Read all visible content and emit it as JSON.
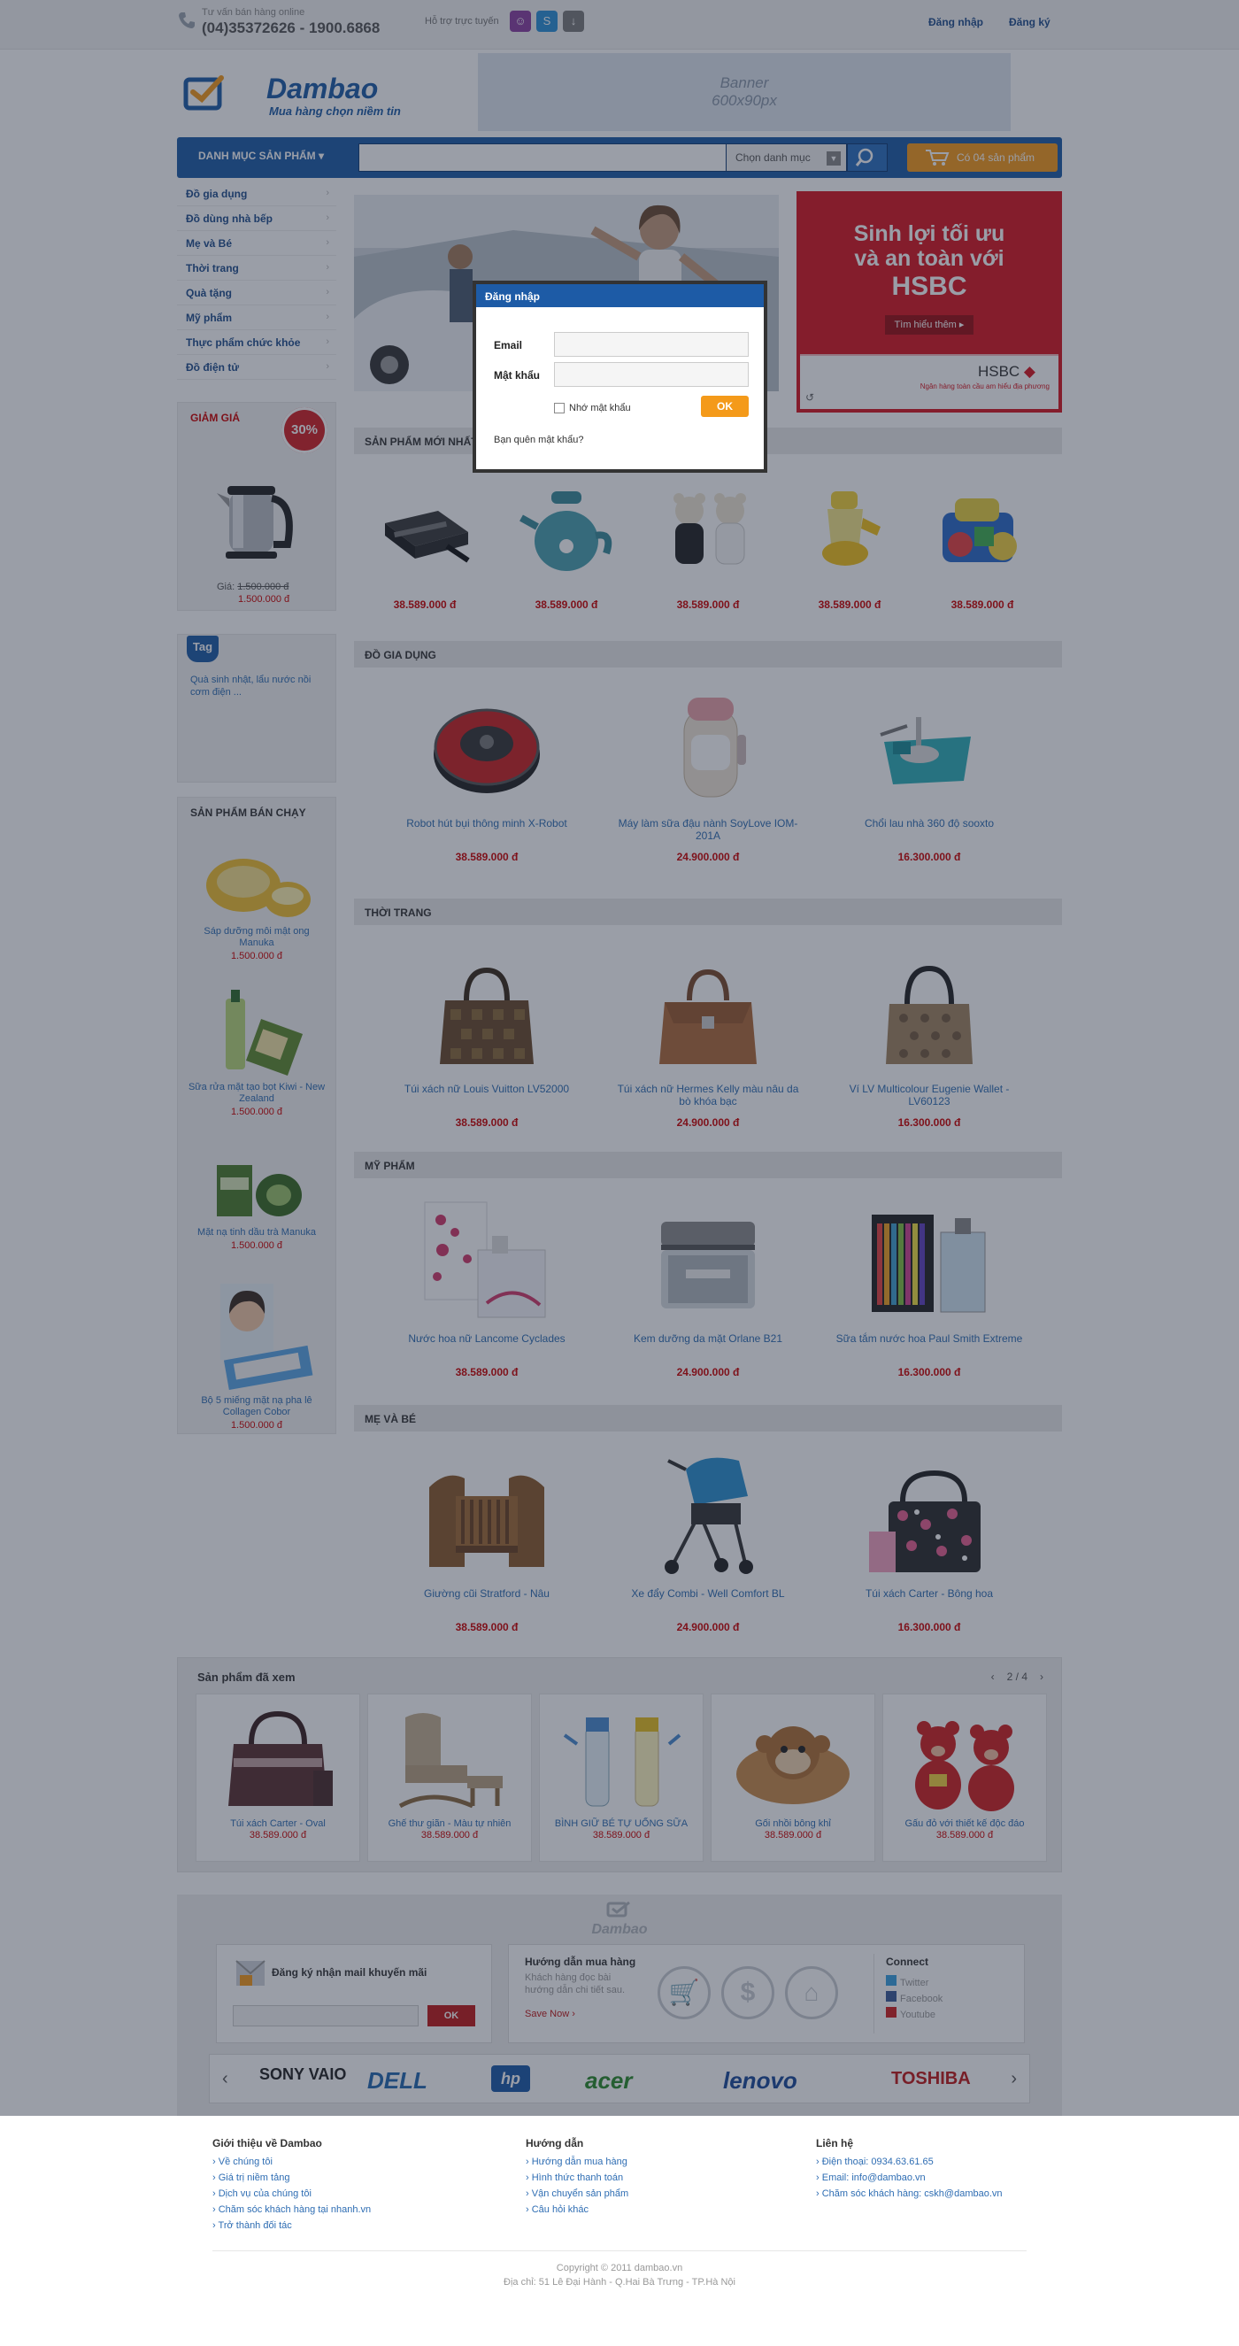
{
  "topbar": {
    "hotline_label": "Tư vấn bán hàng online",
    "hotline_phone": "(04)35372626 - 1900.6868",
    "support_label": "Hỗ trợ trực tuyến",
    "login": "Đăng nhập",
    "register": "Đăng ký"
  },
  "header": {
    "logo_name": "Dambao",
    "logo_slogan": "Mua hàng chọn niềm tin",
    "banner_line1": "Banner",
    "banner_line2": "600x90px"
  },
  "nav": {
    "category_label": "DANH MỤC SẢN PHẨM",
    "search_value": "",
    "category_select": "Chọn danh mục",
    "cart_label": "Có 04 sản phẩm"
  },
  "sidebar": {
    "categories": [
      "Đồ gia dụng",
      "Đồ dùng nhà bếp",
      "Mẹ và Bé",
      "Thời trang",
      "Quà tặng",
      "Mỹ phẩm",
      "Thực phẩm chức khỏe",
      "Đồ điện tử"
    ],
    "discount_title": "GIẢM GIÁ",
    "discount_badge": "30%",
    "discount_price_label": "Giá:",
    "discount_old_price": "1.500.000 đ",
    "discount_new_price": "1.500.000 đ",
    "tag_label": "Tag",
    "tag_text": "Quà sinh nhật, lẩu nước nồi cơm điện ...",
    "bestseller_title": "SẢN PHẨM BÁN CHẠY",
    "bestsellers": [
      {
        "name": "Sáp dưỡng môi mật ong Manuka",
        "price": "1.500.000 đ"
      },
      {
        "name": "Sữa rửa mặt tạo bọt Kiwi - New Zealand",
        "price": "1.500.000 đ"
      },
      {
        "name": "Mặt nạ tinh dầu trà Manuka",
        "price": "1.500.000 đ"
      },
      {
        "name": "Bộ 5 miếng mặt nạ pha lê Collagen Cobor",
        "price": "1.500.000 đ"
      }
    ]
  },
  "hsbc": {
    "line1": "Sinh lợi tối ưu",
    "line2": "và an toàn với",
    "brand": "HSBC",
    "button": "Tìm hiểu thêm",
    "logo": "HSBC",
    "tagline": "Ngân hàng toàn cầu am hiểu địa phương"
  },
  "sections": [
    {
      "title": "SẢN PHẨM MỚI NHẤT",
      "products": [
        {
          "name": "",
          "price": "38.589.000 đ"
        },
        {
          "name": "",
          "price": "38.589.000 đ"
        },
        {
          "name": "",
          "price": "38.589.000 đ"
        },
        {
          "name": "",
          "price": "38.589.000 đ"
        },
        {
          "name": "",
          "price": "38.589.000 đ"
        }
      ]
    },
    {
      "title": "ĐỒ GIA DỤNG",
      "products": [
        {
          "name": "Robot hút bụi thông minh X-Robot",
          "price": "38.589.000 đ"
        },
        {
          "name": "Máy làm sữa đậu nành SoyLove IOM-201A",
          "price": "24.900.000 đ"
        },
        {
          "name": "Chổi lau nhà 360 độ sooxto",
          "price": "16.300.000 đ"
        }
      ]
    },
    {
      "title": "THỜI TRANG",
      "products": [
        {
          "name": "Túi xách nữ Louis Vuitton LV52000",
          "price": "38.589.000 đ"
        },
        {
          "name": "Túi xách nữ Hermes Kelly màu nâu da bò khóa bạc",
          "price": "24.900.000 đ"
        },
        {
          "name": "Ví LV Multicolour Eugenie Wallet - LV60123",
          "price": "16.300.000 đ"
        }
      ]
    },
    {
      "title": "MỸ PHẨM",
      "products": [
        {
          "name": "Nước hoa nữ Lancome Cyclades",
          "price": "38.589.000 đ"
        },
        {
          "name": "Kem dưỡng da mặt Orlane B21",
          "price": "24.900.000 đ"
        },
        {
          "name": "Sữa tắm nước hoa Paul Smith Extreme",
          "price": "16.300.000 đ"
        }
      ]
    },
    {
      "title": "MẸ VÀ BÉ",
      "products": [
        {
          "name": "Giường cũi Stratford - Nâu",
          "price": "38.589.000 đ"
        },
        {
          "name": "Xe đẩy Combi - Well Comfort BL",
          "price": "24.900.000 đ"
        },
        {
          "name": "Túi xách Carter - Bông hoa",
          "price": "16.300.000 đ"
        }
      ]
    }
  ],
  "viewed": {
    "title": "Sản phẩm đã xem",
    "pager": "2 / 4",
    "items": [
      {
        "name": "Túi xách Carter - Oval",
        "price": "38.589.000 đ"
      },
      {
        "name": "Ghế thư giãn - Màu tự nhiên",
        "price": "38.589.000 đ"
      },
      {
        "name": "BÌNH GIỮ BÉ TỰ UỐNG SỮA",
        "price": "38.589.000 đ"
      },
      {
        "name": "Gối nhồi bông khỉ",
        "price": "38.589.000 đ"
      },
      {
        "name": "Gấu đỏ với thiết kế độc đáo",
        "price": "38.589.000 đ"
      }
    ]
  },
  "footer_band": {
    "logo": "Dambao",
    "newsletter_title": "Đăng ký nhận mail khuyến mãi",
    "newsletter_placeholder": "",
    "newsletter_ok": "OK",
    "guide_title": "Hướng dẫn mua hàng",
    "guide_text1": "Khách hàng đọc bài",
    "guide_text2": "hướng dẫn chi tiết sau.",
    "guide_link": "Save Now ›",
    "connect_title": "Connect",
    "connect_items": [
      "Twitter",
      "Facebook",
      "Youtube"
    ],
    "brands": [
      "SONY VAIO",
      "DELL",
      "hp",
      "acer",
      "lenovo",
      "TOSHIBA"
    ]
  },
  "footer": {
    "col1_title": "Giới thiệu về Dambao",
    "col1_items": [
      "Về chúng tôi",
      "Giá trị niềm tảng",
      "Dịch vụ của chúng tôi",
      "Chăm sóc khách hàng tại nhanh.vn",
      "Trở thành đối tác"
    ],
    "col2_title": "Hướng dẫn",
    "col2_items": [
      "Hướng dẫn mua hàng",
      "Hình thức thanh toán",
      "Vận chuyển sản phẩm",
      "Câu hỏi khác"
    ],
    "col3_title": "Liên hệ",
    "col3_items": [
      "Điện thoại: 0934.63.61.65",
      "Email: info@dambao.vn",
      "Chăm sóc khách hàng: cskh@dambao.vn"
    ],
    "copyright": "Copyright © 2011 dambao.vn",
    "address": "Địa chỉ: 51 Lê Đại Hành - Q.Hai Bà Trưng - TP.Hà Nội"
  },
  "modal": {
    "title": "Đăng nhập",
    "email_label": "Email",
    "email_value": "",
    "password_label": "Mật khẩu",
    "password_value": "",
    "remember": "Nhớ mật khẩu",
    "ok": "OK",
    "forgot": "Bạn quên mật khẩu?"
  },
  "colors": {
    "brand_blue": "#1d5ba6",
    "accent_orange": "#f49a1a",
    "price_red": "#cc0000",
    "hsbc_red": "#d8141f"
  }
}
